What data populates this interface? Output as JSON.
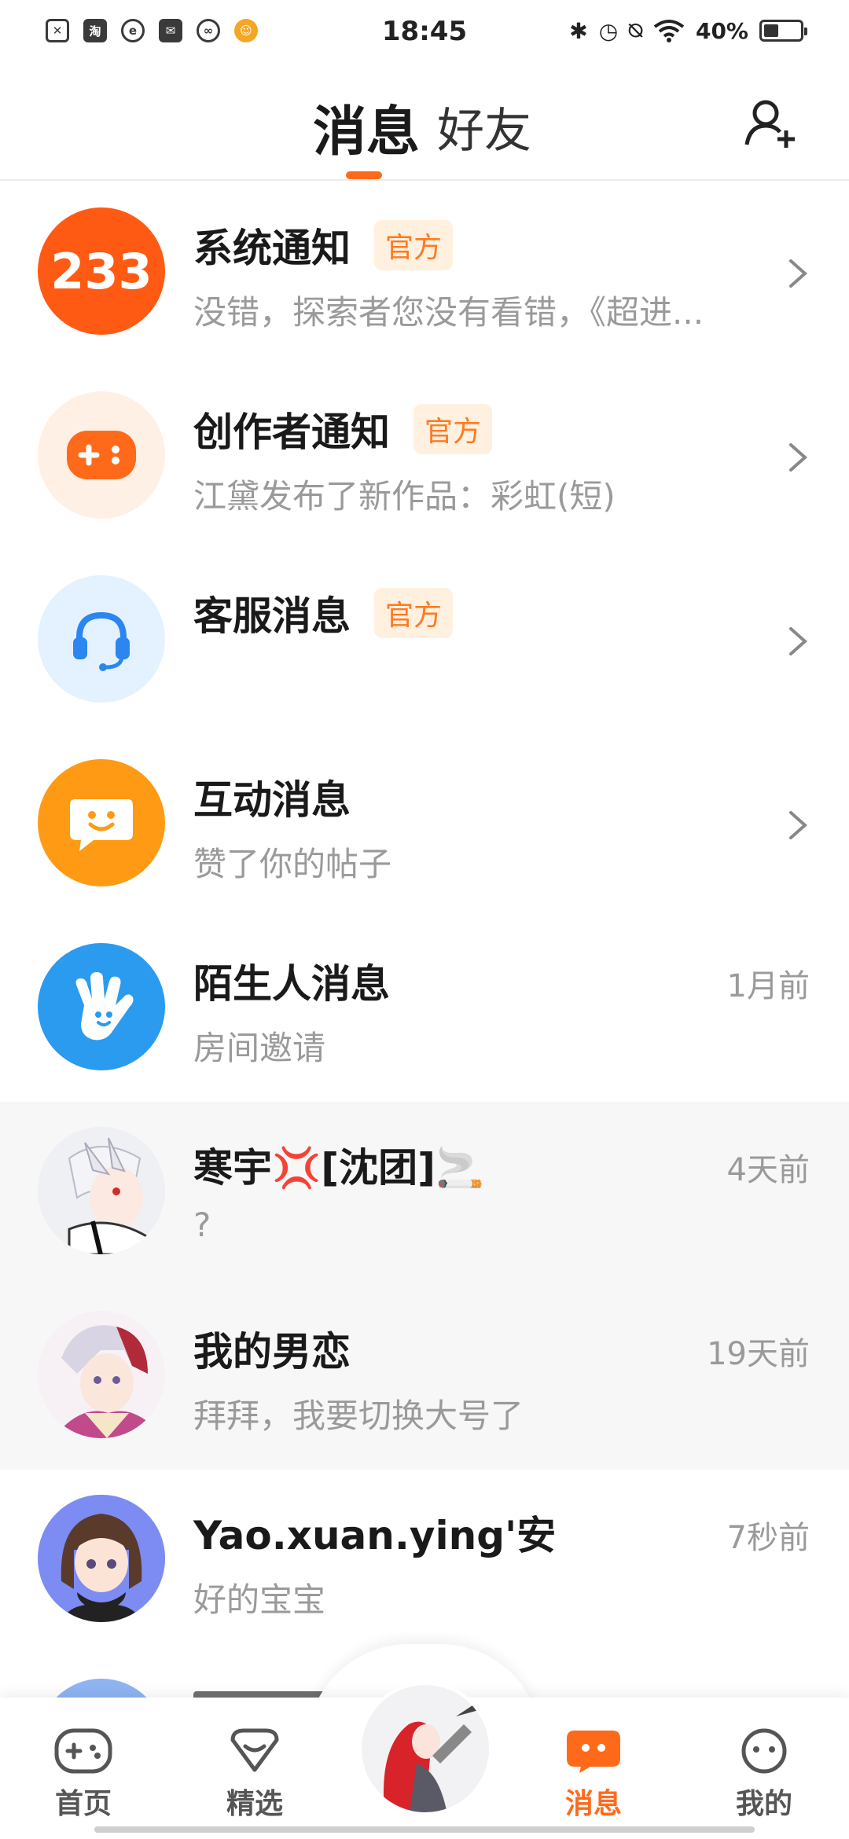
{
  "status_bar": {
    "time": "18:45",
    "battery": "40%",
    "battery_level": 0.4,
    "left_icons": [
      "x-icon",
      "taobao-icon",
      "browser-icon",
      "mail-icon",
      "link-icon",
      "monkey-icon"
    ],
    "taobao_glyph": "淘"
  },
  "header": {
    "tab_messages": "消息",
    "tab_friends": "好友",
    "active_tab": "消息"
  },
  "messages": [
    {
      "name": "系统通知",
      "badge": "官方",
      "subtitle": "没错，探索者您没有看错，《超进...",
      "time": "",
      "avatar_text": "233",
      "avatar_color": "#ff5a14",
      "official": true
    },
    {
      "name": "创作者通知",
      "badge": "官方",
      "subtitle": "江黛发布了新作品：彩虹(短)",
      "time": "",
      "avatar_color": "#fff0e6",
      "official": true
    },
    {
      "name": "客服消息",
      "badge": "官方",
      "subtitle": "",
      "time": "",
      "avatar_color": "#e4f1ff",
      "official": true
    },
    {
      "name": "互动消息",
      "badge": "",
      "subtitle": "赞了你的帖子",
      "time": "",
      "avatar_color": "#ff9a14",
      "official": false
    },
    {
      "name": "陌生人消息",
      "badge": "",
      "subtitle": "房间邀请",
      "time": "1月前",
      "avatar_color": "#2b9bf0",
      "official": false
    },
    {
      "name": "寒宇💢[沈团]🚬",
      "badge": "",
      "subtitle": "?",
      "time": "4天前",
      "pinned": true
    },
    {
      "name": "我的男恋",
      "badge": "",
      "subtitle": "拜拜，我要切换大号了",
      "time": "19天前",
      "pinned": true
    },
    {
      "name": "Yao.xuan.ying'安",
      "badge": "",
      "subtitle": "好的宝宝",
      "time": "7秒前",
      "pinned": false
    }
  ],
  "bottom_nav": {
    "home": "首页",
    "featured": "精选",
    "messages": "消息",
    "mine": "我的",
    "active": "消息"
  },
  "colors": {
    "accent": "#ff6a1a",
    "badge_bg": "#fff0e0",
    "badge_text": "#ff7a1f",
    "pinned_bg": "#f7f7f7"
  }
}
